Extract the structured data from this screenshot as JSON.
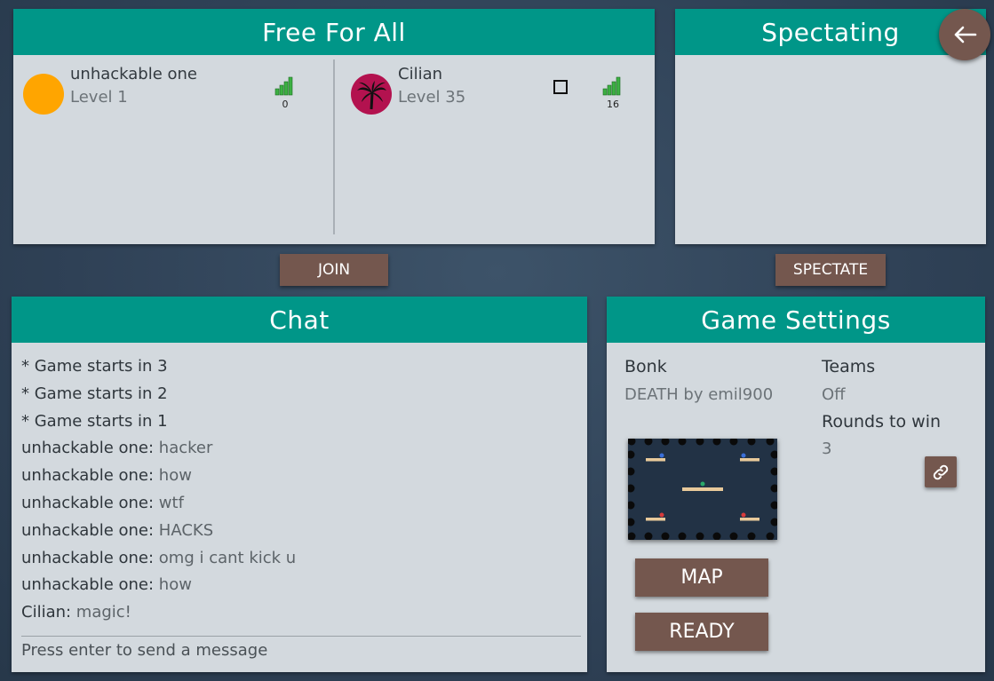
{
  "ffa": {
    "title": "Free For All",
    "players": [
      {
        "name": "unhackable one",
        "level": "Level 1",
        "ping": "0",
        "avatar_color": "#ffa500"
      },
      {
        "name": "Cilian",
        "level": "Level 35",
        "ping": "16",
        "avatar_color": "#b3124f"
      }
    ],
    "join_label": "JOIN"
  },
  "spectating": {
    "title": "Spectating",
    "spectate_label": "SPECTATE"
  },
  "chat": {
    "title": "Chat",
    "messages": [
      {
        "name": "",
        "text": "* Game starts in 3"
      },
      {
        "name": "",
        "text": "* Game starts in 2"
      },
      {
        "name": "",
        "text": "* Game starts in 1"
      },
      {
        "name": "unhackable one: ",
        "text": "hacker"
      },
      {
        "name": "unhackable one: ",
        "text": "how"
      },
      {
        "name": "unhackable one: ",
        "text": "wtf"
      },
      {
        "name": "unhackable one: ",
        "text": "HACKS"
      },
      {
        "name": "unhackable one: ",
        "text": "omg i cant kick u"
      },
      {
        "name": "unhackable one: ",
        "text": "how"
      },
      {
        "name": "Cilian: ",
        "text": "magic!"
      }
    ],
    "input_placeholder": "Press enter to send a message"
  },
  "settings": {
    "title": "Game Settings",
    "mode_label": "Bonk",
    "map_name": "DEATH by emil900",
    "teams_label": "Teams",
    "teams_value": "Off",
    "rounds_label": "Rounds to win",
    "rounds_value": "3",
    "map_button": "MAP",
    "ready_button": "READY"
  },
  "colors": {
    "header_teal": "#009688",
    "button_brown": "#74574e",
    "panel_bg": "#d3d9de",
    "signal_green": "#3cb043"
  },
  "icons": [
    "back-arrow-icon",
    "signal-icon",
    "link-icon",
    "checkbox-icon",
    "palm-tree-icon"
  ]
}
